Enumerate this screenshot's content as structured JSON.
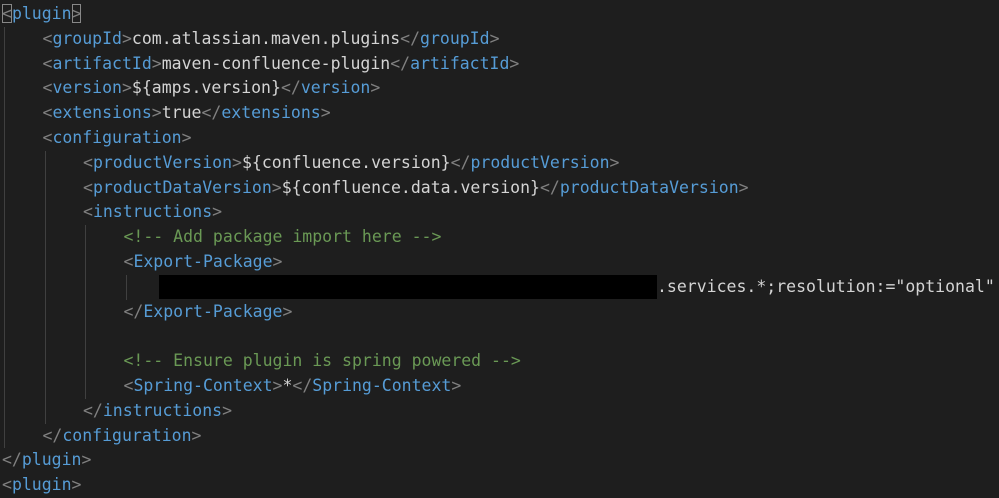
{
  "editor": {
    "lines": [
      {
        "indent": 0,
        "tag": "plugin",
        "type": "open"
      },
      {
        "indent": 1,
        "tag": "groupId",
        "value": "com.atlassian.maven.plugins",
        "type": "element"
      },
      {
        "indent": 1,
        "tag": "artifactId",
        "value": "maven-confluence-plugin",
        "type": "element"
      },
      {
        "indent": 1,
        "tag": "version",
        "value": "${amps.version}",
        "type": "element"
      },
      {
        "indent": 1,
        "tag": "extensions",
        "value": "true",
        "type": "element"
      },
      {
        "indent": 1,
        "tag": "configuration",
        "type": "open"
      },
      {
        "indent": 2,
        "tag": "productVersion",
        "value": "${confluence.version}",
        "type": "element"
      },
      {
        "indent": 2,
        "tag": "productDataVersion",
        "value": "${confluence.data.version}",
        "type": "element"
      },
      {
        "indent": 2,
        "tag": "instructions",
        "type": "open"
      },
      {
        "indent": 3,
        "text": "<!-- Add package import here -->",
        "type": "comment"
      },
      {
        "indent": 3,
        "tag": "Export-Package",
        "type": "open"
      },
      {
        "indent": 3,
        "value": ".services.*;resolution:=\"optional\"",
        "type": "redacted"
      },
      {
        "indent": 3,
        "tag": "Export-Package",
        "type": "close"
      },
      {
        "indent": 0,
        "type": "blank"
      },
      {
        "indent": 3,
        "text": "<!-- Ensure plugin is spring powered -->",
        "type": "comment"
      },
      {
        "indent": 3,
        "tag": "Spring-Context",
        "value": "*",
        "type": "element"
      },
      {
        "indent": 2,
        "tag": "instructions",
        "type": "close"
      },
      {
        "indent": 1,
        "tag": "configuration",
        "type": "close"
      },
      {
        "indent": 0,
        "tag": "plugin",
        "type": "close"
      },
      {
        "indent": 0,
        "tag": "plugin",
        "type": "open"
      }
    ]
  },
  "colors": {
    "background": "#1e1e1e",
    "tag": "#569cd6",
    "bracket": "#808080",
    "text": "#d4d4d4",
    "comment": "#6a9955",
    "redaction": "#000000"
  }
}
